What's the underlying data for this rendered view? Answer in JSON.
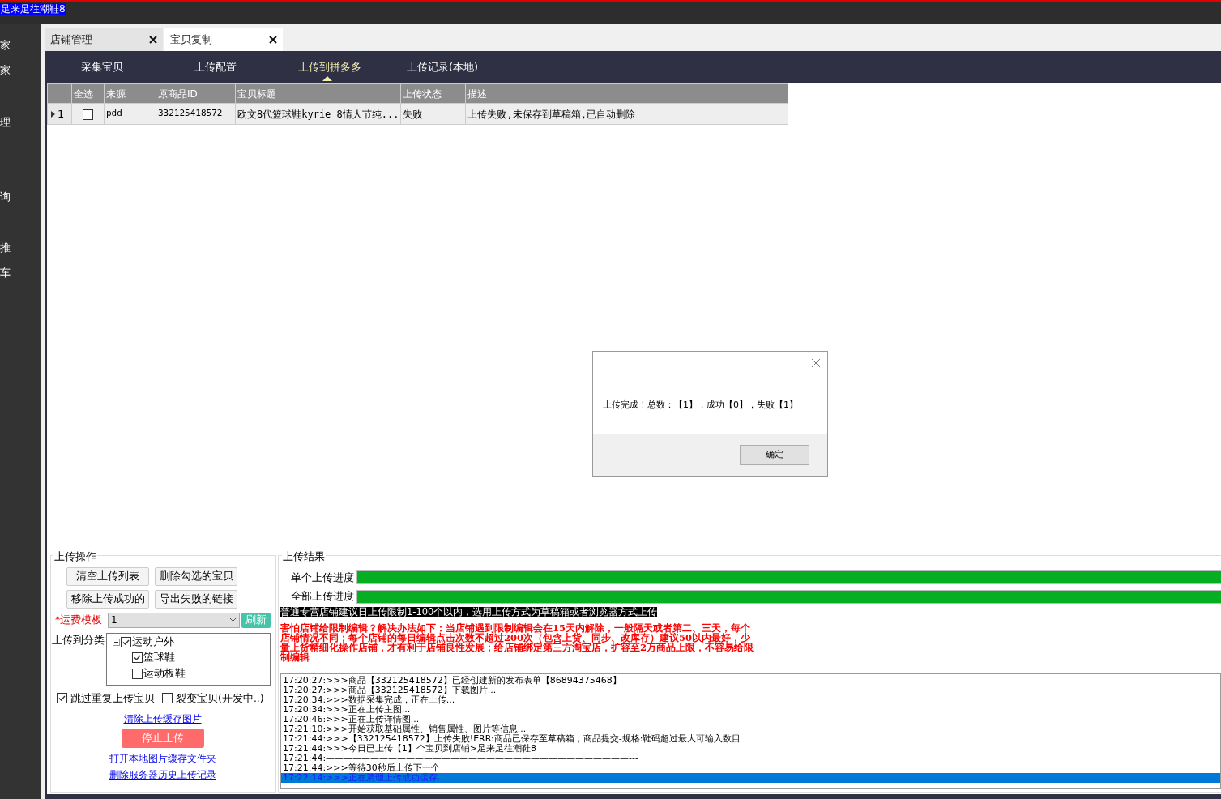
{
  "top_bar": {
    "shop_name": "足来足往潮鞋8"
  },
  "sidebar": {
    "items": [
      "家",
      "家",
      "理",
      "询",
      "推",
      "车"
    ]
  },
  "tabs": [
    {
      "label": "店铺管理",
      "selected": false
    },
    {
      "label": "宝贝复制",
      "selected": true
    }
  ],
  "nav": [
    {
      "label": "采集宝贝",
      "selected": false
    },
    {
      "label": "上传配置",
      "selected": false
    },
    {
      "label": "上传到拼多多",
      "selected": true
    },
    {
      "label": "上传记录(本地)",
      "selected": false
    }
  ],
  "table": {
    "select_all": "全选",
    "columns": [
      "来源",
      "原商品ID",
      "宝贝标题",
      "上传状态",
      "描述"
    ],
    "rows": [
      {
        "number": "1",
        "checked": false,
        "cells": [
          "pdd",
          "332125418572",
          "欧文8代篮球鞋kyrie 8情人节纯...",
          "失败",
          "上传失败,未保存到草稿箱,已自动删除"
        ]
      }
    ]
  },
  "upload_ops": {
    "title": "上传操作",
    "buttons": [
      "清空上传列表",
      "删除勾选的宝贝",
      "移除上传成功的",
      "导出失败的链接"
    ],
    "shipping_label": "*运费模板",
    "shipping_value": "1",
    "refresh": "刷新",
    "category_label": "上传到分类",
    "tree": [
      {
        "label": "运动户外",
        "checked": true,
        "expanded": true,
        "children": [
          {
            "label": "篮球鞋",
            "checked": true
          },
          {
            "label": "运动板鞋",
            "checked": false
          }
        ]
      }
    ],
    "options": [
      {
        "label": "跳过重复上传宝贝",
        "checked": true
      },
      {
        "label": "裂变宝贝(开发中..)",
        "checked": false
      }
    ],
    "clear_link": "清除上传缓存图片",
    "stop_button": "停止上传",
    "links": [
      "打开本地图片缓存文件夹",
      "删除服务器历史上传记录"
    ]
  },
  "results": {
    "title": "上传结果",
    "progress": [
      {
        "label": "单个上传进度",
        "level": 1
      },
      {
        "label": "全部上传进度",
        "level": 1
      }
    ],
    "notice": "普通专营店铺建议日上传限制1-100个以内，选用上传方式为草稿箱或者浏览器方式上传",
    "warning": "害怕店铺给限制编辑？解决办法如下：当店铺遇到限制编辑会在15天内解除，一般隔天或者第二、三天，每个店铺情况不同；每个店铺的每日编辑点击次数不超过200次（包含上货、同步、改库存）建议50以内最好，少量上货精细化操作店铺，才有利于店铺良性发展；给店铺绑定第三方淘宝店，扩容至2万商品上限，不容易给限制编辑",
    "log": [
      {
        "text": "17:20:27:>>>商品【332125418572】已经创建新的发布表单【86894375468】",
        "selected": false
      },
      {
        "text": "17:20:27:>>>商品【332125418572】下载图片...",
        "selected": false
      },
      {
        "text": "17:20:34:>>>数据采集完成，正在上传...",
        "selected": false
      },
      {
        "text": "17:20:34:>>>正在上传主图...",
        "selected": false
      },
      {
        "text": "17:20:46:>>>正在上传详情图...",
        "selected": false
      },
      {
        "text": "17:21:10:>>>开始获取基础属性、销售属性、图片等信息...",
        "selected": false
      },
      {
        "text": "17:21:44:>>>【332125418572】上传失败!ERR:商品已保存至草稿箱，商品提交-规格:鞋码超过最大可输入数目",
        "selected": false
      },
      {
        "text": "17:21:44:>>>今日已上传【1】个宝贝到店铺>足来足往潮鞋8",
        "selected": false
      },
      {
        "text": "17:21:44:——————————————————————————————————---",
        "selected": false
      },
      {
        "text": "17:21:44:>>>等待30秒后上传下一个",
        "selected": false
      },
      {
        "text": "17:22:14:>>>正在清理上传成功缓存...",
        "selected": true
      }
    ]
  },
  "dialog": {
    "message": "上传完成！总数：【1】，成功【0】，失败【1】",
    "ok": "确定"
  }
}
